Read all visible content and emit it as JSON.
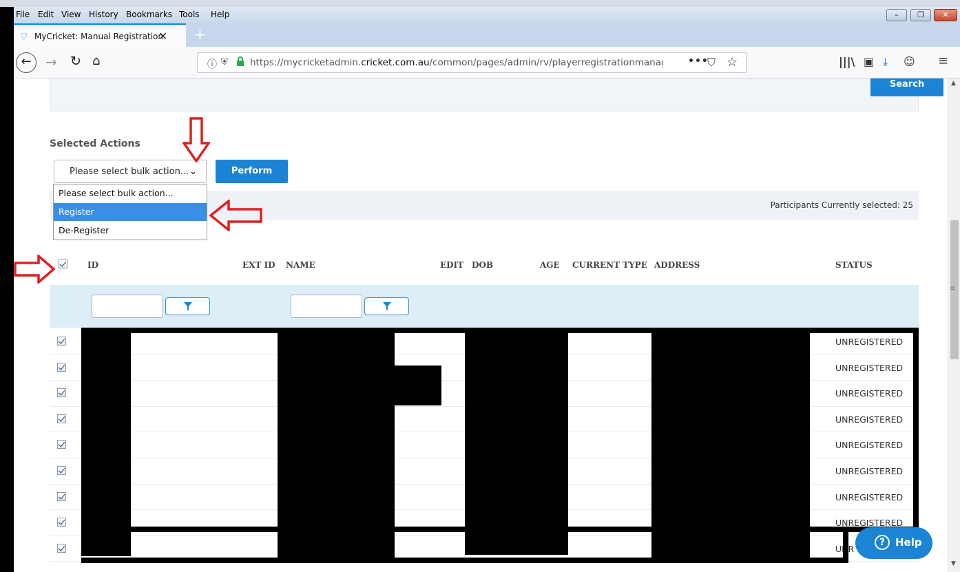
{
  "menu": [
    "File",
    "Edit",
    "View",
    "History",
    "Bookmarks",
    "Tools",
    "Help"
  ],
  "window_controls": {
    "minimize": "–",
    "maximize": "❐",
    "close": "✕"
  },
  "tab": {
    "title": "MyCricket: Manual Registration",
    "close": "✕",
    "new_tab": "+"
  },
  "url": {
    "prefix": "https://mycricketadmin.",
    "domain": "cricket.com.au",
    "path": "/common/pages/admin/rv/playerregistrationmanage",
    "more": "•••"
  },
  "search": {
    "button_label": "Search"
  },
  "actions": {
    "heading": "Selected Actions",
    "select_value": "Please select bulk action...",
    "perform_label": "Perform",
    "options": [
      "Please select bulk action...",
      "Register",
      "De-Register"
    ],
    "selected_option": "Register"
  },
  "participants_text": "Participants Currently selected: 25",
  "table": {
    "headers": {
      "id": "ID",
      "ext_id": "EXT ID",
      "name": "NAME",
      "edit": "EDIT",
      "dob": "DOB",
      "age": "AGE",
      "current_type": "CURRENT TYPE",
      "address": "ADDRESS",
      "status": "STATUS"
    },
    "rows": [
      {
        "status": "UNREGISTERED"
      },
      {
        "status": "UNREGISTERED"
      },
      {
        "status": "UNREGISTERED"
      },
      {
        "status": "UNREGISTERED"
      },
      {
        "status": "UNREGISTERED"
      },
      {
        "status": "UNREGISTERED"
      },
      {
        "status": "UNREGISTERED"
      },
      {
        "status": "UNREGISTERED"
      },
      {
        "status": "UNR"
      }
    ]
  },
  "help": {
    "label": "Help",
    "icon": "?"
  },
  "colors": {
    "primary_button": "#1b84d4",
    "annotation_arrow": "#e02020",
    "selected_option": "#3a8ee6"
  }
}
